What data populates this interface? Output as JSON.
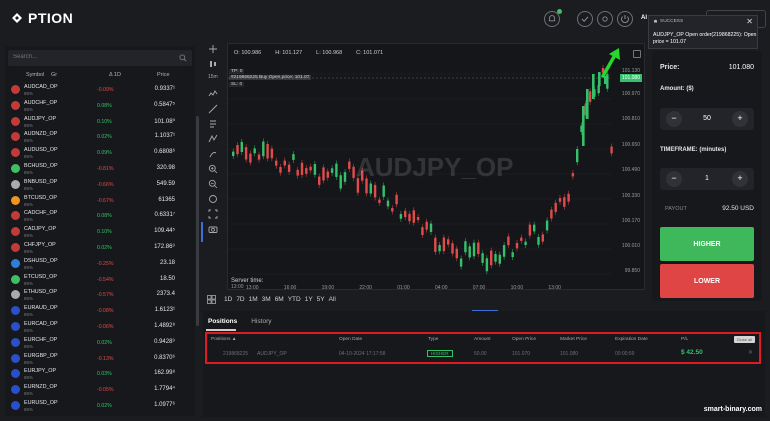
{
  "header": {
    "logo_text": "PTION",
    "account_initials": "Al"
  },
  "search": {
    "placeholder": "Search..."
  },
  "asset_columns": {
    "symbol": "Symbol",
    "gr": "Gr",
    "change": "Δ 1D",
    "price": "Price"
  },
  "assets": [
    {
      "name": "AUDCAD_OP",
      "payout": "85%",
      "change": "-0.09%",
      "dir": "neg",
      "price": "0.9337¹",
      "color": "#c23a3a"
    },
    {
      "name": "AUDCHF_OP",
      "payout": "85%",
      "change": "0.08%",
      "dir": "pos",
      "price": "0.5847⁵",
      "color": "#c23a3a"
    },
    {
      "name": "AUDJPY_OP",
      "payout": "85%",
      "change": "0.10%",
      "dir": "pos",
      "price": "101.08⁰",
      "color": "#c23a3a"
    },
    {
      "name": "AUDNZD_OP",
      "payout": "85%",
      "change": "0.02%",
      "dir": "pos",
      "price": "1.1037¹",
      "color": "#c23a3a"
    },
    {
      "name": "AUDUSD_OP",
      "payout": "85%",
      "change": "0.09%",
      "dir": "pos",
      "price": "0.6808⁶",
      "color": "#c23a3a"
    },
    {
      "name": "BCHUSD_OP",
      "payout": "85%",
      "change": "-0.81%",
      "dir": "neg",
      "price": "320.98",
      "color": "#3fbf61"
    },
    {
      "name": "BNBUSD_OP",
      "payout": "85%",
      "change": "-0.66%",
      "dir": "neg",
      "price": "549.59",
      "color": "#aaaaaa"
    },
    {
      "name": "BTCUSD_OP",
      "payout": "85%",
      "change": "-0.67%",
      "dir": "neg",
      "price": "61365",
      "color": "#f0961e"
    },
    {
      "name": "CADCHF_OP",
      "payout": "85%",
      "change": "0.08%",
      "dir": "pos",
      "price": "0.6331⁷",
      "color": "#c23a3a"
    },
    {
      "name": "CADJPY_OP",
      "payout": "85%",
      "change": "0.10%",
      "dir": "pos",
      "price": "109.44⁵",
      "color": "#c23a3a"
    },
    {
      "name": "CHFJPY_OP",
      "payout": "85%",
      "change": "0.02%",
      "dir": "pos",
      "price": "172.86⁹",
      "color": "#c23a3a"
    },
    {
      "name": "DSHUSD_OP",
      "payout": "85%",
      "change": "-0.25%",
      "dir": "neg",
      "price": "23.18",
      "color": "#2f7fd8"
    },
    {
      "name": "ETCUSD_OP",
      "payout": "85%",
      "change": "-0.54%",
      "dir": "neg",
      "price": "18.50",
      "color": "#3fbf61"
    },
    {
      "name": "ETHUSD_OP",
      "payout": "85%",
      "change": "-0.57%",
      "dir": "neg",
      "price": "2373.4",
      "color": "#aaaaaa"
    },
    {
      "name": "EURAUD_OP",
      "payout": "85%",
      "change": "-0.08%",
      "dir": "neg",
      "price": "1.6123¹",
      "color": "#2a4fc9"
    },
    {
      "name": "EURCAD_OP",
      "payout": "85%",
      "change": "-0.06%",
      "dir": "neg",
      "price": "1.4892⁸",
      "color": "#2a4fc9"
    },
    {
      "name": "EURCHF_OP",
      "payout": "85%",
      "change": "0.02%",
      "dir": "pos",
      "price": "0.9428⁹",
      "color": "#2a4fc9"
    },
    {
      "name": "EURGBP_OP",
      "payout": "85%",
      "change": "-0.13%",
      "dir": "neg",
      "price": "0.8370⁶",
      "color": "#2a4fc9"
    },
    {
      "name": "EURJPY_OP",
      "payout": "85%",
      "change": "0.03%",
      "dir": "pos",
      "price": "162.99⁸",
      "color": "#2a4fc9"
    },
    {
      "name": "EURNZD_OP",
      "payout": "85%",
      "change": "-0.05%",
      "dir": "neg",
      "price": "1.7794⁴",
      "color": "#2a4fc9"
    },
    {
      "name": "EURUSD_OP",
      "payout": "85%",
      "change": "0.02%",
      "dir": "pos",
      "price": "1.0977⁶",
      "color": "#2a4fc9"
    }
  ],
  "chart": {
    "open": "O: 100.986",
    "high": "H: 101.127",
    "low": "L: 100.968",
    "close": "C: 101.071",
    "tp_label": "TP: 0",
    "open_order_label": "#219868225  Buy  Open price: 101.07",
    "sl_label": "SL: 0",
    "watermark": "AUDJPY_OP",
    "current_price": "101.080",
    "server_time_label": "Server time:",
    "server_time_value": "13:00",
    "y_ticks": [
      "101.130",
      "101.080",
      "100.970",
      "100.810",
      "100.650",
      "100.490",
      "100.330",
      "100.170",
      "100.010",
      "99.850"
    ],
    "x_ticks": [
      "13:00",
      "16:00",
      "19:00",
      "22:00",
      "01:00",
      "04:00",
      "07:00",
      "10:00",
      "13:00"
    ]
  },
  "timeframes": [
    "1D",
    "7D",
    "1M",
    "3M",
    "6M",
    "YTD",
    "1Y",
    "5Y",
    "All"
  ],
  "trade_panel": {
    "price_label": "Price:",
    "price_value": "101.080",
    "amount_label": "Amount: ($)",
    "amount_value": "50",
    "timeframe_label": "TIMEFRAME: (minutes)",
    "timeframe_value": "1",
    "payout_label": "PAYOUT",
    "payout_value": "92.50 USD",
    "higher_label": "HIGHER",
    "lower_label": "LOWER"
  },
  "toast": {
    "title": "SUCCESS",
    "message": "AUDJPY_OP Open order(219868225): Open price = 101.07"
  },
  "positions": {
    "tabs": [
      "Positions",
      "History"
    ],
    "headers": [
      "Positions ▲",
      "Open Date",
      "Type",
      "Amount",
      "Open Price",
      "Market Price",
      "Expiration Date",
      "P/L"
    ],
    "close_all": "Close all",
    "row": {
      "id": "219868225",
      "asset": "AUDJPY_OP",
      "open_date": "04-10-2024 17:17:58",
      "type": "HIGHER",
      "amount": "50.00",
      "open_price": "101.070",
      "market_price": "101.080",
      "expiration": "00:00:59",
      "pl": "$ 42.50"
    }
  },
  "footer": {
    "site": "smart-binary.com"
  },
  "colors": {
    "up": "#36c06b",
    "down": "#e14b4b",
    "accent": "#3d6fd6",
    "highlight": "#e01a22"
  }
}
